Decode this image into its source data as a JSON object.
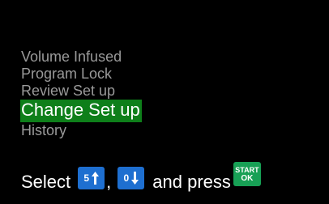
{
  "menu": {
    "items": [
      {
        "label": "Volume Infused",
        "selected": false
      },
      {
        "label": "Program Lock",
        "selected": false
      },
      {
        "label": "Review Set up",
        "selected": false
      },
      {
        "label": "Change Set up",
        "selected": true
      },
      {
        "label": "History",
        "selected": false
      }
    ]
  },
  "footer": {
    "select_text": "Select",
    "key_up_digit": "5",
    "key_up_icon": "arrow-up-icon",
    "comma": ",",
    "key_down_digit": "0",
    "key_down_icon": "arrow-down-icon",
    "and_press_text": "and press",
    "start_key_top": "START",
    "start_key_bottom": "OK"
  },
  "colors": {
    "background": "#000000",
    "menu_text": "#9a9a9a",
    "selected_bg": "#0e7f1a",
    "selected_text": "#ffffff",
    "key_blue": "#1e6fd0",
    "start_green": "#17a055"
  }
}
